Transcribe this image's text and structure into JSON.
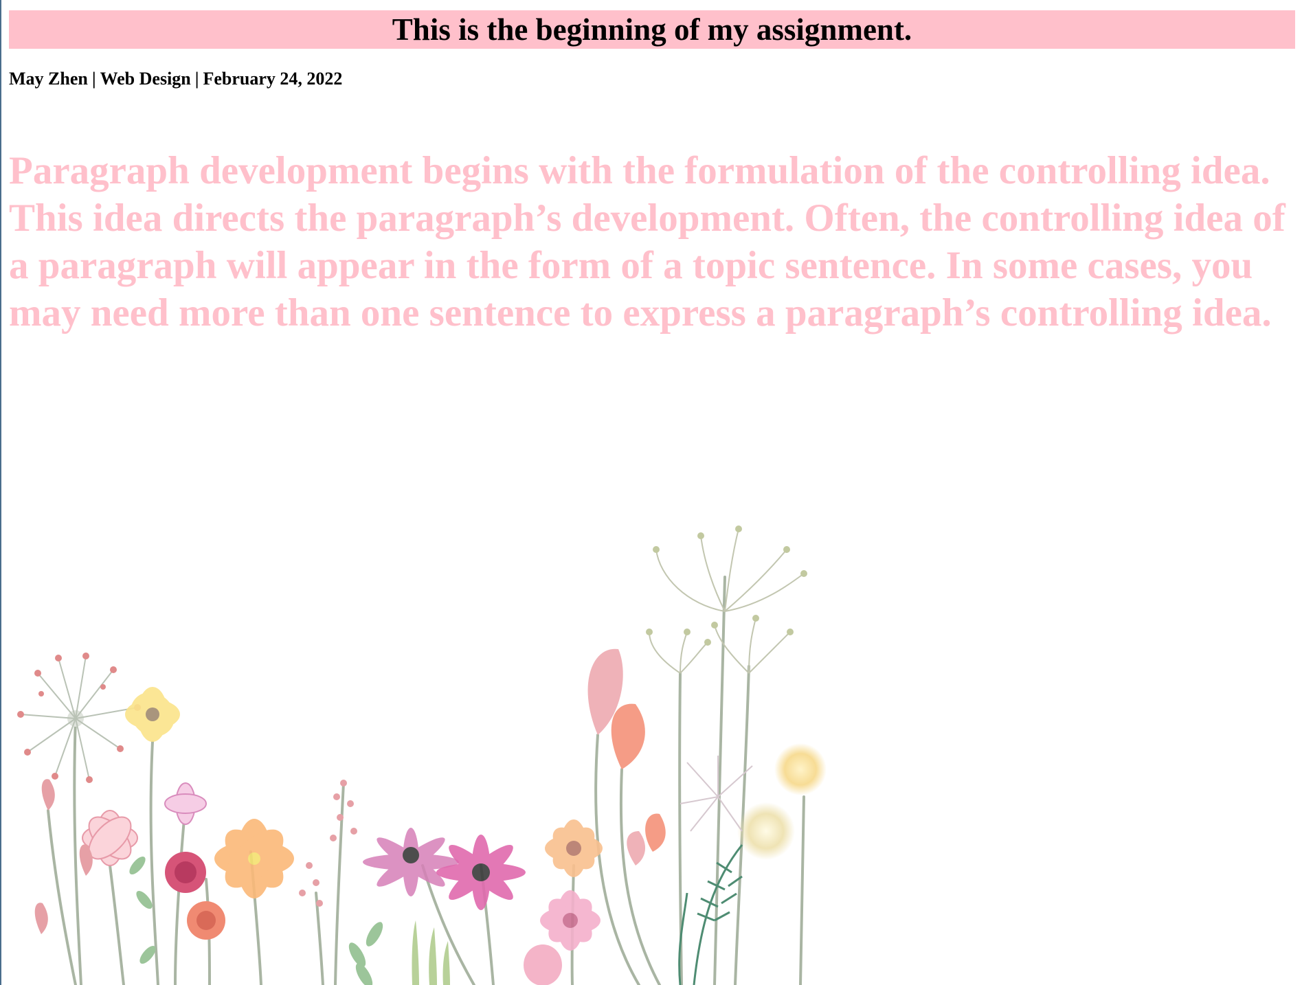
{
  "header": {
    "title": "This is the beginning of my assignment."
  },
  "byline": {
    "author": "May Zhen",
    "separator": "|",
    "course": "Web Design",
    "date": "February 24, 2022"
  },
  "main": {
    "paragraph": "Paragraph development begins with the formulation of the controlling idea. This idea directs the paragraph’s development. Often, the controlling idea of a paragraph will appear in the form of a topic sentence. In some cases, you may need more than one sentence to express a paragraph’s controlling idea."
  },
  "colors": {
    "title_background": "#ffc0cb",
    "paragraph_text": "#ffc0cb",
    "heading_text": "#000000"
  },
  "illustration": {
    "subject": "watercolor-wildflowers-illustration"
  }
}
